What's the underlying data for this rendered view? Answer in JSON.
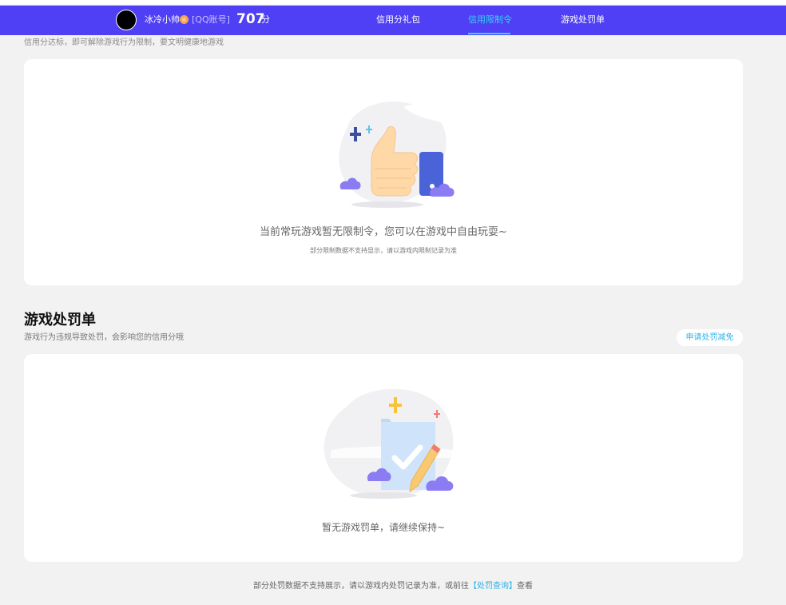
{
  "header": {
    "username": "冰冷小帅",
    "account_type": "[QQ账号]",
    "score": "707",
    "score_unit": "分",
    "tabs": [
      {
        "label": "信用分礼包"
      },
      {
        "label": "信用限制令"
      },
      {
        "label": "游戏处罚单"
      }
    ],
    "active_tab": "信用限制令",
    "colors": {
      "bar": "#4f3ff5",
      "active": "#34d3f2"
    }
  },
  "restriction_section": {
    "subtitle": "信用分达标，即可解除游戏行为限制，要文明健康地游戏",
    "empty_message": "当前常玩游戏暂无限制令，您可以在游戏中自由玩耍~",
    "note": "部分限制数据不支持显示，请以游戏内限制记录为准",
    "illustration": "thumbs-up-icon"
  },
  "penalty_section": {
    "title": "游戏处罚单",
    "subtitle": "游戏行为违规导致处罚，会影响您的信用分哦",
    "apply_button": "申请处罚减免",
    "empty_message": "暂无游戏罚单，请继续保持~",
    "illustration": "clipboard-check-icon"
  },
  "footer": {
    "text_before": "部分处罚数据不支持展示，请以游戏内处罚记录为准，或前往",
    "link_text": "【处罚查询】",
    "text_after": "查看"
  }
}
